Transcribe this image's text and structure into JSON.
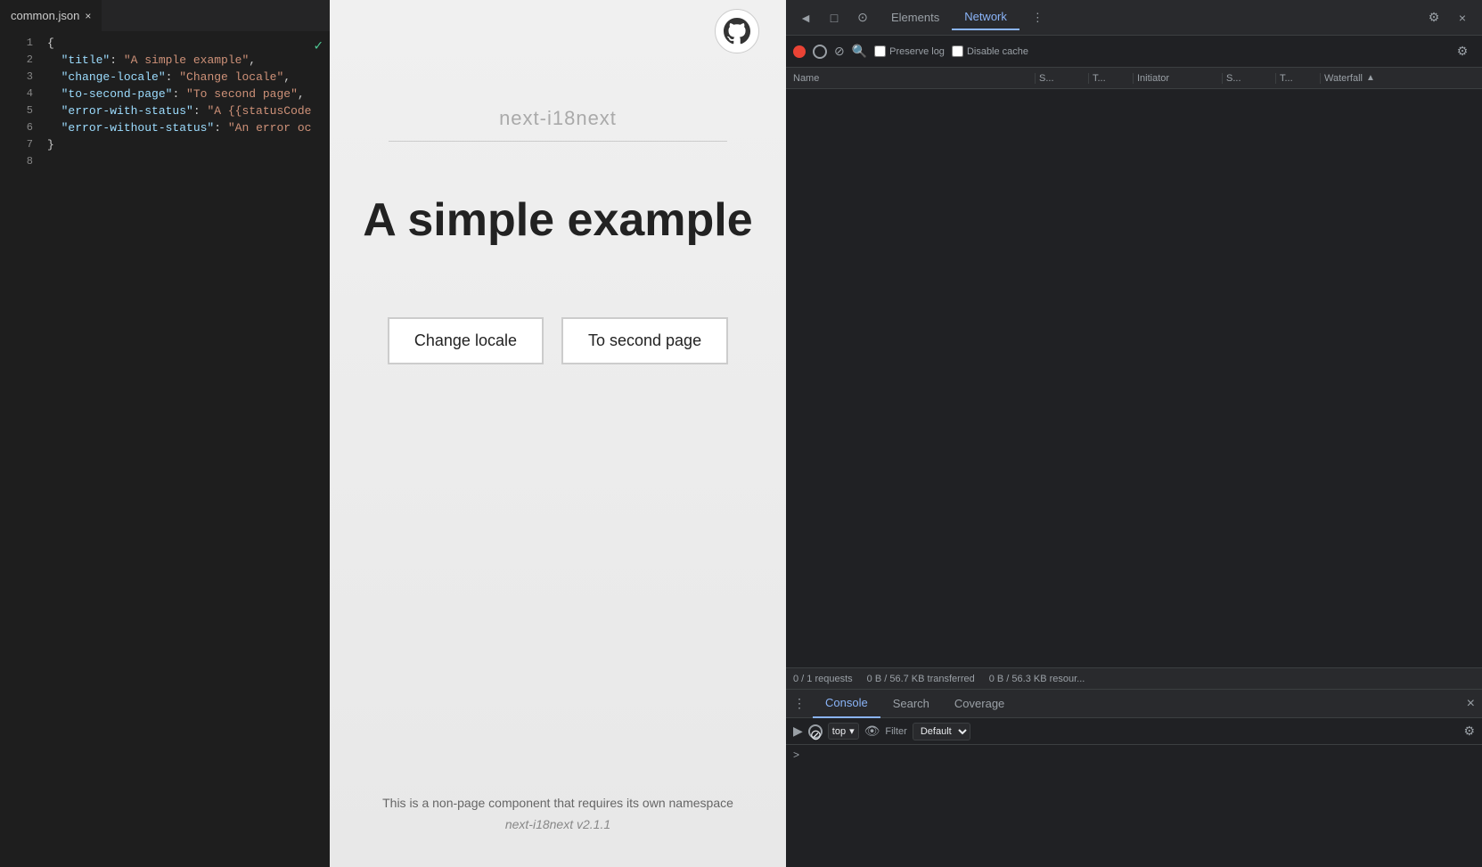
{
  "editor": {
    "tab": {
      "filename": "common.json",
      "close_icon": "×"
    },
    "check_icon": "✓",
    "lines": [
      {
        "number": "1",
        "content": "{",
        "type": "punct"
      },
      {
        "number": "2",
        "content": "  \"title\": \"A simple example\",",
        "key": "\"title\"",
        "val": "\"A simple example\""
      },
      {
        "number": "3",
        "content": "  \"change-locale\": \"Change locale\",",
        "key": "\"change-locale\"",
        "val": "\"Change locale\""
      },
      {
        "number": "4",
        "content": "  \"to-second-page\": \"To second page\",",
        "key": "\"to-second-page\"",
        "val": "\"To second page\""
      },
      {
        "number": "5",
        "content": "  \"error-with-status\": \"A {{statusCode",
        "key": "\"error-with-status\"",
        "val": "\"A {{statusCode"
      },
      {
        "number": "6",
        "content": "  \"error-without-status\": \"An error oc",
        "key": "\"error-without-status\"",
        "val": "\"An error oc"
      },
      {
        "number": "7",
        "content": "}",
        "type": "punct"
      },
      {
        "number": "8",
        "content": ""
      }
    ]
  },
  "browser": {
    "github_btn_title": "GitHub",
    "subtitle": "next-i18next",
    "divider": true,
    "title": "A simple example",
    "buttons": {
      "change_locale": "Change locale",
      "to_second_page": "To second page"
    },
    "footer": {
      "namespace": "This is a non-page component that requires its own namespace",
      "version": "next-i18next v2.1.1"
    }
  },
  "devtools": {
    "topbar": {
      "tabs": [
        {
          "label": "◄",
          "active": false
        },
        {
          "label": "□",
          "active": false
        },
        {
          "label": "⊙",
          "active": false
        },
        {
          "label": "Elements",
          "active": false
        },
        {
          "label": "Network",
          "active": true
        },
        {
          "label": "⋮",
          "active": false
        }
      ],
      "close_btn": "×",
      "settings_btn": "⚙",
      "more_btn": "⋮"
    },
    "network": {
      "toolbar": {
        "record_title": "Record",
        "clear_title": "Clear",
        "filter_title": "Filter",
        "search_title": "Search",
        "preserve_log": "Preserve log",
        "disable_cache": "Disable cache",
        "settings_icon": "⚙"
      },
      "table": {
        "headers": [
          "Name",
          "S...",
          "T...",
          "Initiator",
          "S...",
          "T...",
          "Waterfall"
        ]
      },
      "status": {
        "requests": "0 / 1 requests",
        "transferred": "0 B / 56.7 KB transferred",
        "resources": "0 B / 56.3 KB resour..."
      }
    },
    "console": {
      "tabs": [
        "Console",
        "Search",
        "Coverage"
      ],
      "close_icon": "×",
      "toolbar": {
        "exec_icon": "▶",
        "block_icon": "⊘",
        "context": "top",
        "context_arrow": "▾",
        "eye_icon": "👁",
        "filter_label": "Filter",
        "filter_default": "Default",
        "settings_icon": "⚙"
      },
      "prompt_chevron": ">"
    }
  }
}
